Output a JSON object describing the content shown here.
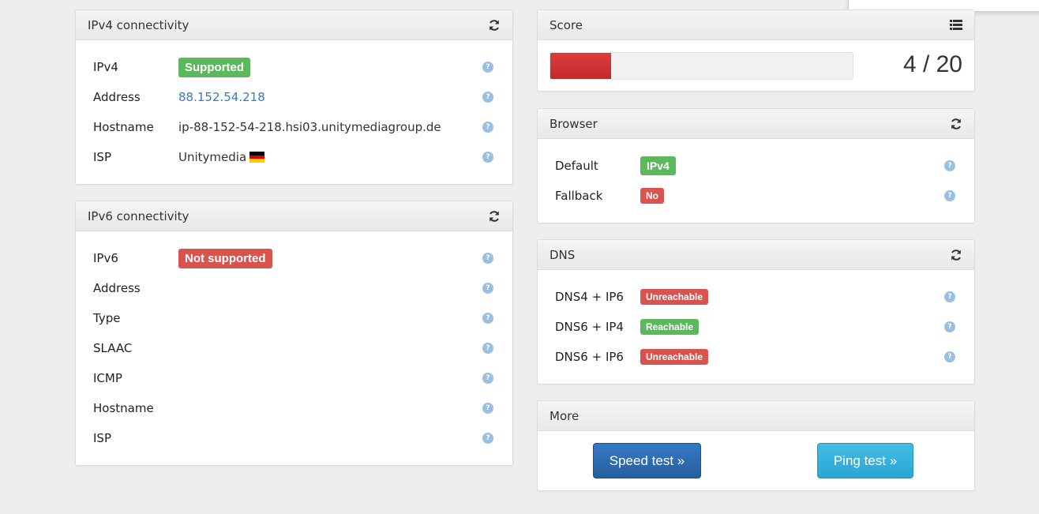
{
  "ipv4": {
    "title": "IPv4 connectivity",
    "rows": {
      "ipv4": {
        "label": "IPv4",
        "value": "Supported"
      },
      "address": {
        "label": "Address",
        "value": "88.152.54.218"
      },
      "hostname": {
        "label": "Hostname",
        "value": "ip-88-152-54-218.hsi03.unitymediagroup.de"
      },
      "isp": {
        "label": "ISP",
        "value": "Unitymedia"
      }
    }
  },
  "ipv6": {
    "title": "IPv6 connectivity",
    "rows": {
      "ipv6": {
        "label": "IPv6",
        "value": "Not supported"
      },
      "address": {
        "label": "Address"
      },
      "type": {
        "label": "Type"
      },
      "slaac": {
        "label": "SLAAC"
      },
      "icmp": {
        "label": "ICMP"
      },
      "hostname": {
        "label": "Hostname"
      },
      "isp": {
        "label": "ISP"
      }
    }
  },
  "score": {
    "title": "Score",
    "text": "4 / 20",
    "fraction": 0.2
  },
  "browser": {
    "title": "Browser",
    "rows": {
      "default": {
        "label": "Default",
        "value": "IPv4"
      },
      "fallback": {
        "label": "Fallback",
        "value": "No"
      }
    }
  },
  "dns": {
    "title": "DNS",
    "rows": {
      "dns4ip6": {
        "label": "DNS4 + IP6",
        "value": "Unreachable"
      },
      "dns6ip4": {
        "label": "DNS6 + IP4",
        "value": "Reachable"
      },
      "dns6ip6": {
        "label": "DNS6 + IP6",
        "value": "Unreachable"
      }
    }
  },
  "more": {
    "title": "More",
    "speed_test": "Speed test »",
    "ping_test": "Ping test »"
  },
  "icons": {
    "help": "?",
    "refresh": "refresh-icon",
    "list": "list-icon",
    "flag": "germany-flag-icon"
  },
  "colors": {
    "success": "#5cb85c",
    "danger": "#d9534f",
    "primary": "#337ab7",
    "info": "#31b0d5"
  }
}
